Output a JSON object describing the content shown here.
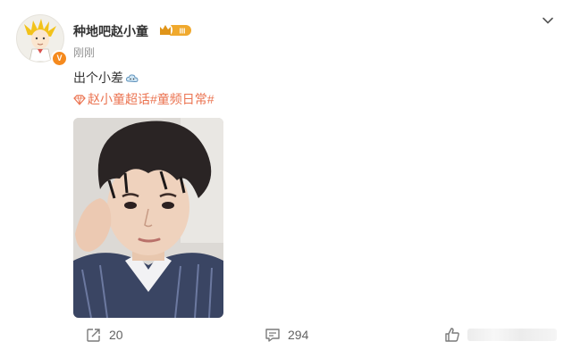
{
  "post": {
    "username": "种地吧赵小童",
    "badge_text": "III",
    "verified_mark": "V",
    "time": "刚刚",
    "text": "出个小差",
    "topic": "赵小童超话#童频日常#",
    "icons": {
      "menu": "chevron-down-icon",
      "emoji": "cloud-emoji-icon",
      "topic": "diamond-topic-icon",
      "repost": "share-icon",
      "comment": "comment-icon",
      "like": "thumbs-up-icon"
    },
    "colors": {
      "topic": "#eb7350",
      "verified": "#f58a1e",
      "badge": "#f0a92d"
    }
  },
  "actions": {
    "repost_count": "20",
    "comment_count": "294"
  }
}
